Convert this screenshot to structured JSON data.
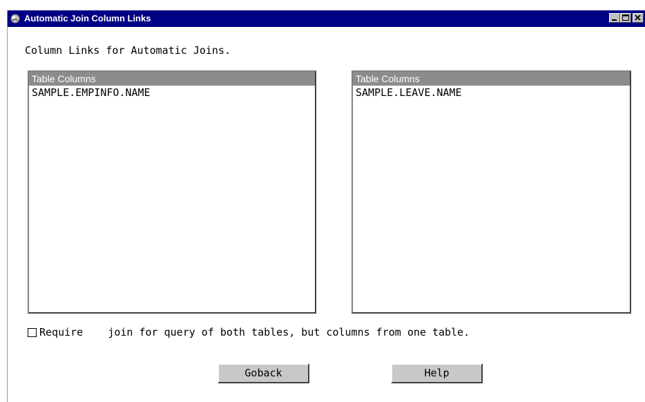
{
  "window": {
    "title": "Automatic Join Column Links",
    "title_icon": "sas-app-icon",
    "controls": [
      "minimize-icon",
      "maximize-icon",
      "close-icon"
    ],
    "titlebar_color": "#000084"
  },
  "main": {
    "heading": "Column Links for Automatic Joins.",
    "left_list": {
      "header": "Table Columns",
      "items": [
        "SAMPLE.EMPINFO.NAME"
      ]
    },
    "right_list": {
      "header": "Table Columns",
      "items": [
        "SAMPLE.LEAVE.NAME"
      ]
    },
    "require_checkbox": {
      "checked": false,
      "label": "Require    join for query of both tables, but columns from one table."
    }
  },
  "buttons": {
    "goback": "Goback",
    "help": "Help"
  }
}
